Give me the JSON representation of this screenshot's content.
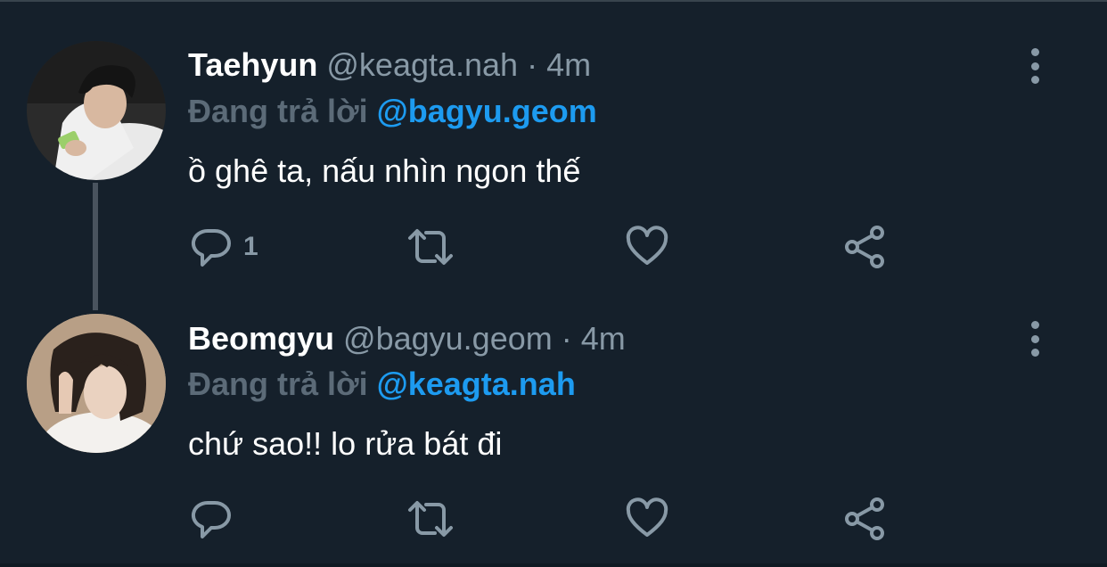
{
  "tweets": [
    {
      "name": "Taehyun",
      "handle": "@keagta.nah",
      "separator": "·",
      "time": "4m",
      "reply_prefix": "Đang trả lời",
      "reply_mention": "@bagyu.geom",
      "text": "ồ ghê ta, nấu nhìn ngon thế",
      "reply_count": "1",
      "avatar_icon": "user-avatar"
    },
    {
      "name": "Beomgyu",
      "handle": "@bagyu.geom",
      "separator": "·",
      "time": "4m",
      "reply_prefix": "Đang trả lời",
      "reply_mention": "@keagta.nah",
      "text": "chứ sao!! lo rửa bát đi",
      "reply_count": "",
      "avatar_icon": "user-avatar"
    }
  ],
  "icons": {
    "reply": "reply-icon",
    "retweet": "retweet-icon",
    "like": "like-icon",
    "share": "share-icon",
    "more": "more-options-icon"
  },
  "colors": {
    "background": "#15202b",
    "text": "#ffffff",
    "secondary": "#8899a6",
    "mention": "#1d9bf0",
    "thread_line": "#49535e"
  }
}
